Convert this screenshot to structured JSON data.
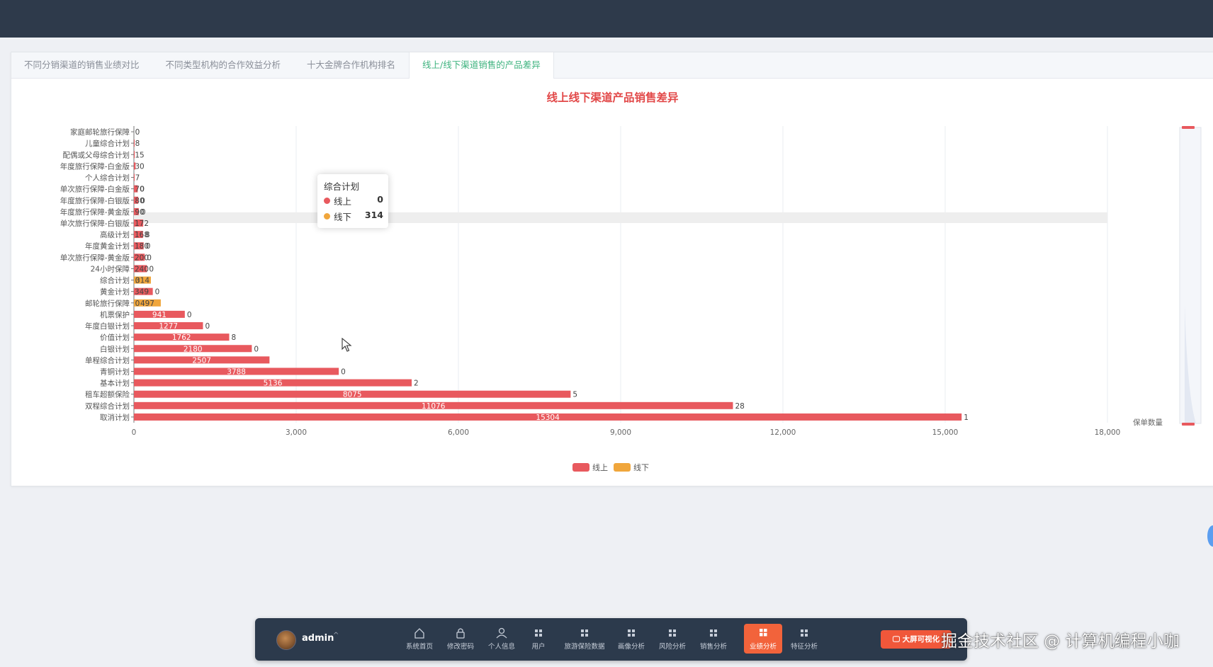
{
  "tabs": [
    {
      "label": "不同分销渠道的销售业绩对比",
      "active": false
    },
    {
      "label": "不同类型机构的合作效益分析",
      "active": false
    },
    {
      "label": "十大金牌合作机构排名",
      "active": false
    },
    {
      "label": "线上/线下渠道销售的产品差异",
      "active": true
    }
  ],
  "colors": {
    "online": "#e8595e",
    "offline": "#f0a63c",
    "title": "#e24848",
    "active_tab": "#3fb37f",
    "dock_active": "#f2633b"
  },
  "chart_data": {
    "type": "bar",
    "orientation": "horizontal",
    "stacked": true,
    "title": "线上线下渠道产品销售差异",
    "xlabel": "保单数量",
    "xlim": [
      0,
      18000
    ],
    "x_ticks": [
      "0",
      "3,000",
      "6,000",
      "9,000",
      "12,000",
      "15,000",
      "18,000"
    ],
    "x_tick_values": [
      0,
      3000,
      6000,
      9000,
      12000,
      15000,
      18000
    ],
    "grid": true,
    "legend_position": "bottom-center",
    "categories": [
      "家庭邮轮旅行保障",
      "儿童综合计划",
      "配偶或父母综合计划",
      "年度旅行保障-白金版",
      "个人综合计划",
      "单次旅行保障-白金版",
      "年度旅行保障-白银版",
      "年度旅行保障-黄金版",
      "单次旅行保障-白银版",
      "高级计划",
      "年度黄金计划",
      "单次旅行保障-黄金版",
      "24小时保障",
      "综合计划",
      "黄金计划",
      "邮轮旅行保障",
      "机票保护",
      "年度白银计划",
      "价值计划",
      "白银计划",
      "单程综合计划",
      "青铜计划",
      "基本计划",
      "租车超额保险",
      "双程综合计划",
      "取消计划"
    ],
    "series": [
      {
        "name": "线上",
        "values": [
          0,
          8,
          15,
          30,
          7,
          70,
          80,
          90,
          172,
          168,
          180,
          200,
          240,
          0,
          349,
          0,
          941,
          1277,
          1762,
          2180,
          2507,
          3788,
          5136,
          8075,
          11076,
          15304
        ]
      },
      {
        "name": "线下",
        "values": [
          0,
          0,
          0,
          0,
          0,
          0,
          0,
          0,
          0,
          0,
          0,
          0,
          0,
          314,
          0,
          497,
          0,
          0,
          0,
          0,
          0,
          0,
          0,
          0,
          0,
          0
        ]
      }
    ],
    "value_labels": {
      "online": [
        "0",
        "8",
        "15",
        "30",
        "7",
        "70",
        "80",
        "90",
        "172",
        "168",
        "180",
        "200",
        "240",
        "0",
        "349",
        "0",
        "941",
        "1277",
        "1762",
        "2180",
        "2507",
        "3788",
        "5136",
        "8075",
        "11076",
        "15304"
      ],
      "offline": [
        "",
        "",
        "",
        "",
        "",
        "0",
        "0",
        "0",
        "",
        "8",
        "0",
        "0",
        "0",
        "314",
        "0",
        "497",
        "0",
        "0",
        "8",
        "0",
        "",
        "0",
        "2",
        "5",
        "28",
        "1"
      ]
    },
    "highlighted_category": "综合计划"
  },
  "tooltip": {
    "title": "综合计划",
    "rows": [
      {
        "name": "线上",
        "value": "0"
      },
      {
        "name": "线下",
        "value": "314"
      }
    ]
  },
  "dock": {
    "username": "admin",
    "caret": "^",
    "items": [
      {
        "label": "系统首页",
        "icon": "home-icon"
      },
      {
        "label": "修改密码",
        "icon": "lock-icon"
      },
      {
        "label": "个人信息",
        "icon": "user-icon"
      },
      {
        "label": "用户",
        "icon": "grid-icon"
      },
      {
        "label": "旅游保险数据",
        "icon": "grid-icon"
      },
      {
        "label": "画像分析",
        "icon": "grid-icon"
      },
      {
        "label": "风险分析",
        "icon": "grid-icon"
      },
      {
        "label": "销售分析",
        "icon": "grid-icon"
      },
      {
        "label": "业绩分析",
        "icon": "grid-icon",
        "active": true
      },
      {
        "label": "特征分析",
        "icon": "grid-icon"
      }
    ],
    "bigscreen_label": "大屏可视化"
  },
  "watermark": "掘金技术社区 @ 计算机编程小咖"
}
